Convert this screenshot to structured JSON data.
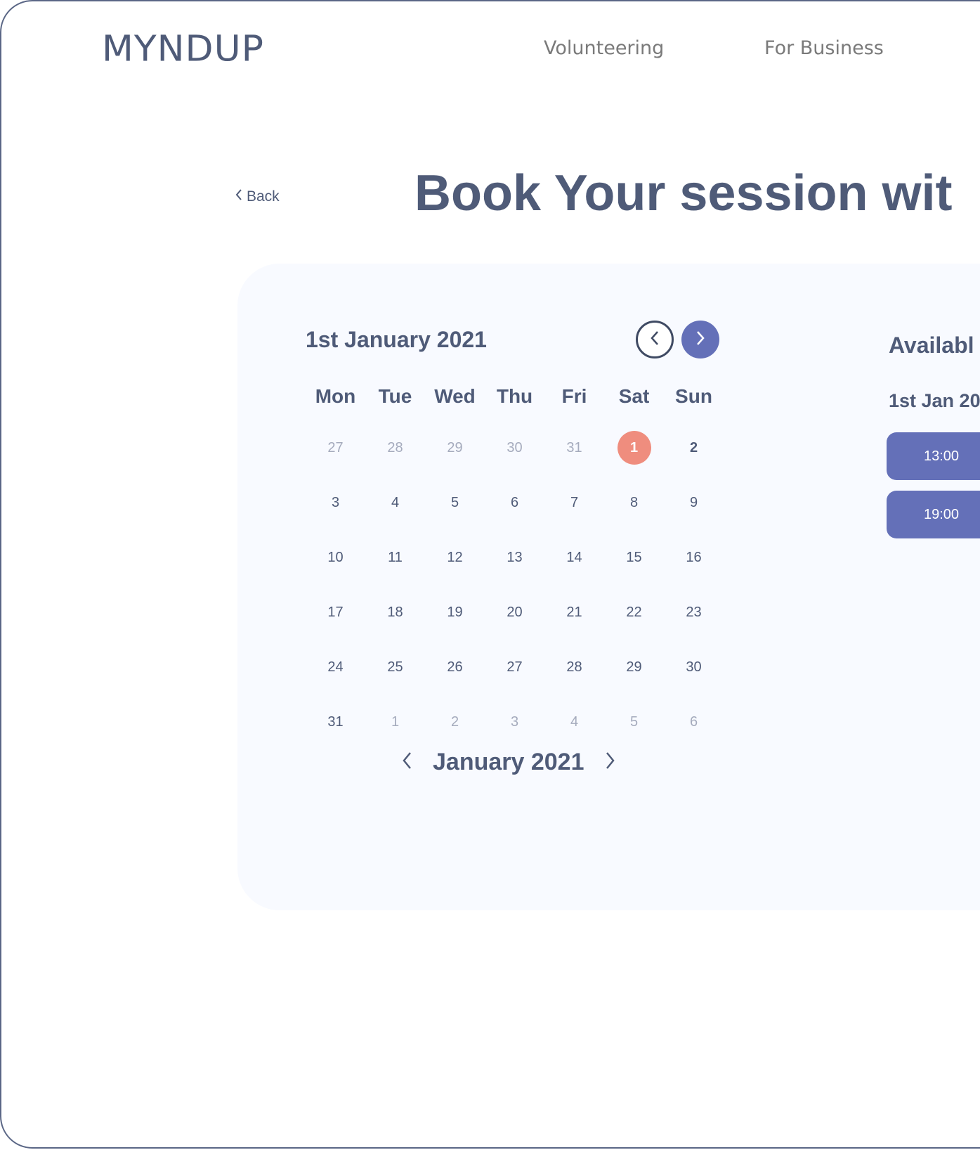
{
  "header": {
    "logo": "MYNDUP",
    "nav": [
      {
        "label": "Volunteering"
      },
      {
        "label": "For Business"
      }
    ]
  },
  "page": {
    "back_label": "Back",
    "title": "Book Your session wit"
  },
  "calendar": {
    "selected_heading": "1st January 2021",
    "prev_icon": "chevron-left-icon",
    "next_icon": "chevron-right-icon",
    "weekdays": [
      "Mon",
      "Tue",
      "Wed",
      "Thu",
      "Fri",
      "Sat",
      "Sun"
    ],
    "weeks": [
      [
        {
          "d": "27",
          "muted": true
        },
        {
          "d": "28",
          "muted": true
        },
        {
          "d": "29",
          "muted": true
        },
        {
          "d": "30",
          "muted": true
        },
        {
          "d": "31",
          "muted": true
        },
        {
          "d": "1",
          "selected": true
        },
        {
          "d": "2",
          "bold": true
        }
      ],
      [
        {
          "d": "3"
        },
        {
          "d": "4"
        },
        {
          "d": "5"
        },
        {
          "d": "6"
        },
        {
          "d": "7"
        },
        {
          "d": "8"
        },
        {
          "d": "9"
        }
      ],
      [
        {
          "d": "10"
        },
        {
          "d": "11"
        },
        {
          "d": "12"
        },
        {
          "d": "13"
        },
        {
          "d": "14"
        },
        {
          "d": "15"
        },
        {
          "d": "16"
        }
      ],
      [
        {
          "d": "17"
        },
        {
          "d": "18"
        },
        {
          "d": "19"
        },
        {
          "d": "20"
        },
        {
          "d": "21"
        },
        {
          "d": "22"
        },
        {
          "d": "23"
        }
      ],
      [
        {
          "d": "24"
        },
        {
          "d": "25"
        },
        {
          "d": "26"
        },
        {
          "d": "27"
        },
        {
          "d": "28"
        },
        {
          "d": "29"
        },
        {
          "d": "30"
        }
      ],
      [
        {
          "d": "31"
        },
        {
          "d": "1",
          "muted": true
        },
        {
          "d": "2",
          "muted": true
        },
        {
          "d": "3",
          "muted": true
        },
        {
          "d": "4",
          "muted": true
        },
        {
          "d": "5",
          "muted": true
        },
        {
          "d": "6",
          "muted": true
        }
      ]
    ],
    "month_label": "January 2021"
  },
  "availability": {
    "title": "Availabl",
    "date": "1st Jan 20",
    "slots": [
      "13:00",
      "19:00"
    ]
  },
  "colors": {
    "text": "#4f5b78",
    "accent": "#6470b8",
    "selected_day": "#ef8d7e",
    "panel_bg": "#f8faff",
    "nav_text": "#7a7a7a"
  }
}
